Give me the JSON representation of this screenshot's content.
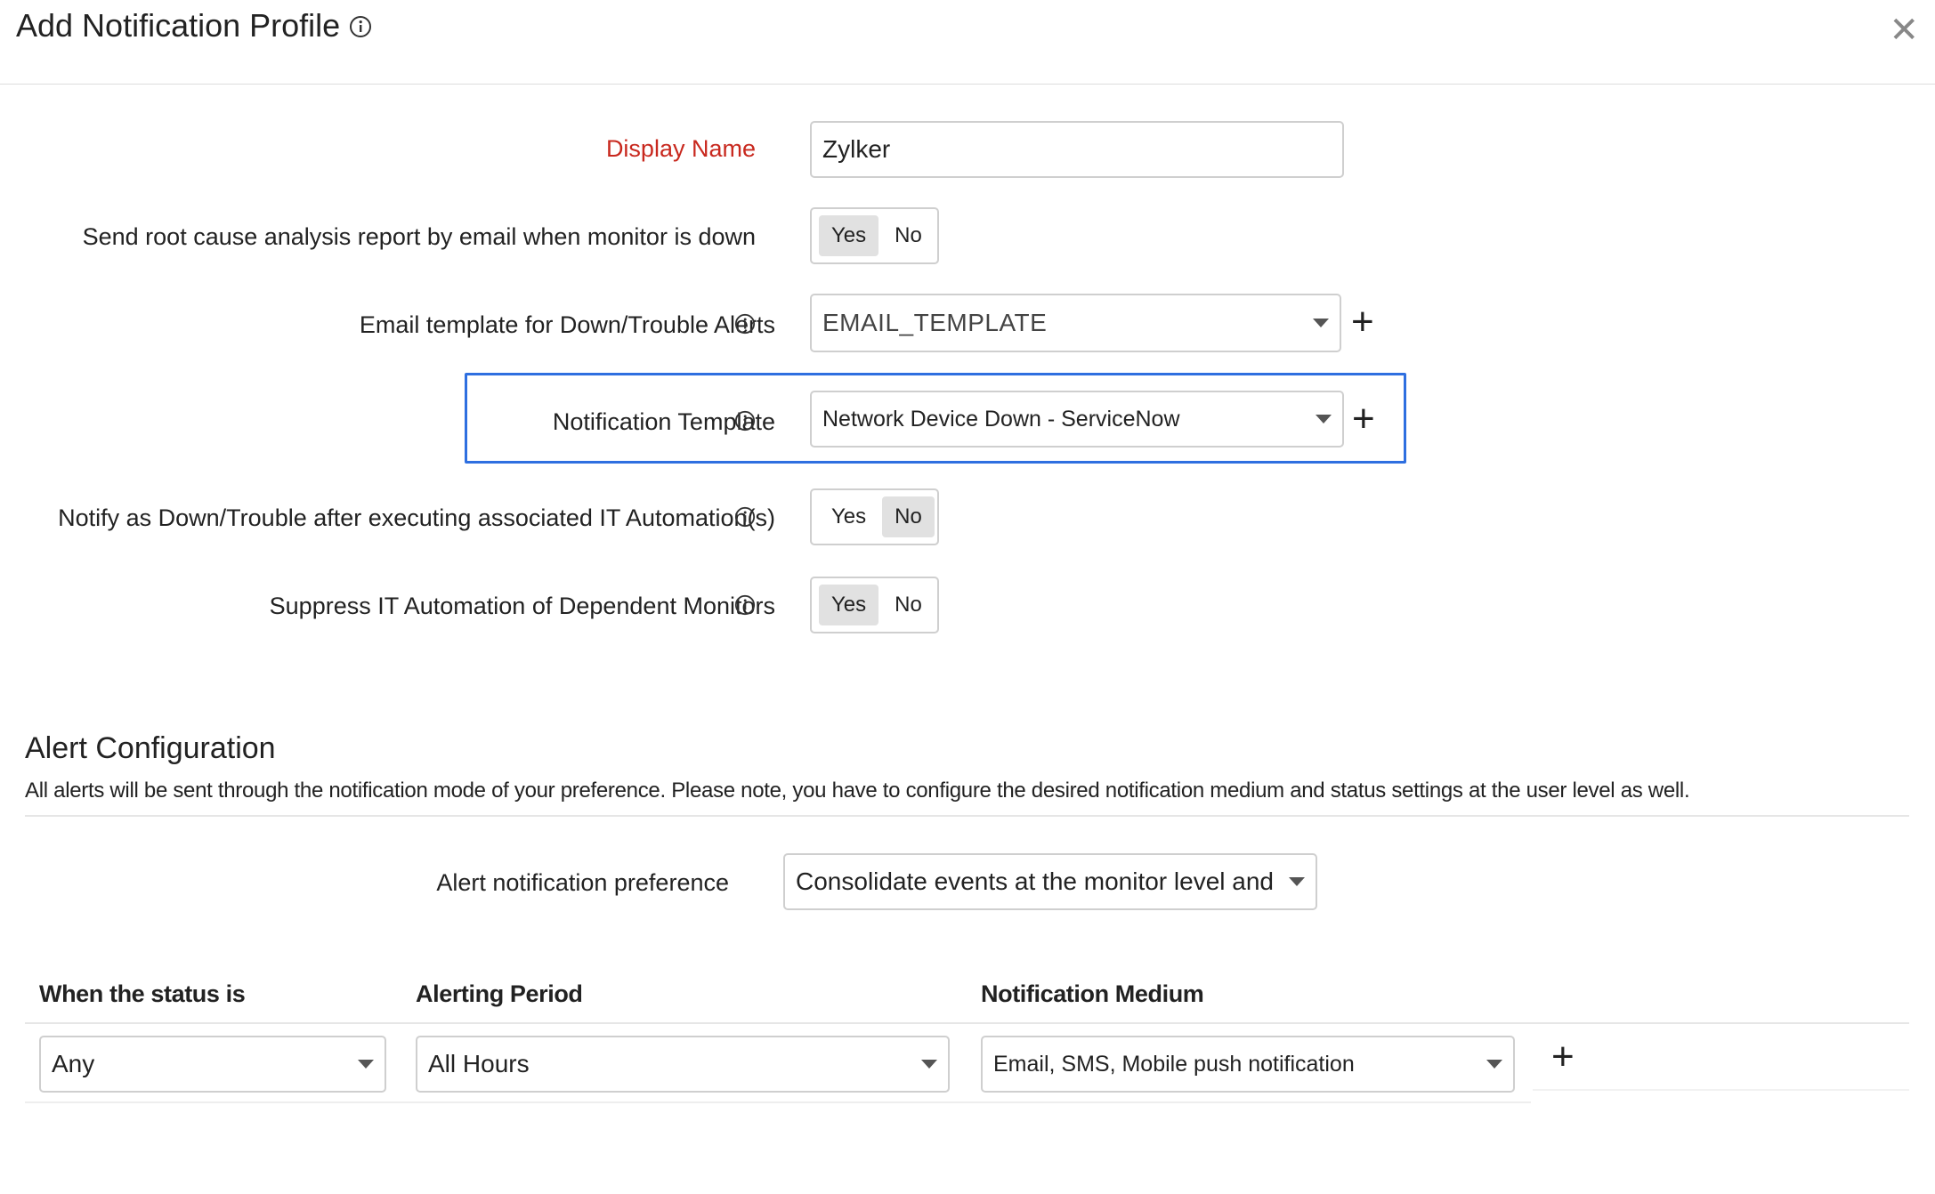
{
  "dialog": {
    "title": "Add Notification Profile",
    "close_label": "✕"
  },
  "form": {
    "display_name": {
      "label": "Display Name",
      "value": "Zylker"
    },
    "rca_email": {
      "label": "Send root cause analysis report by email when monitor is down",
      "yes": "Yes",
      "no": "No",
      "selected": "Yes"
    },
    "email_template": {
      "label": "Email template for Down/Trouble Alerts",
      "value": "EMAIL_TEMPLATE"
    },
    "notification_template": {
      "label": "Notification Template",
      "value": "Network Device Down - ServiceNow"
    },
    "notify_after_automation": {
      "label": "Notify as Down/Trouble after executing associated IT Automation(s)",
      "yes": "Yes",
      "no": "No",
      "selected": "No"
    },
    "suppress_automation": {
      "label": "Suppress IT Automation of Dependent Monitors",
      "yes": "Yes",
      "no": "No",
      "selected": "Yes"
    },
    "add_symbol": "+"
  },
  "alert_config": {
    "title": "Alert Configuration",
    "description": "All alerts will be sent through the notification mode of your preference. Please note, you have to configure the desired notification medium and status settings at the user level as well.",
    "preference": {
      "label": "Alert notification preference",
      "value": "Consolidate events at the monitor level and not"
    },
    "table": {
      "headers": [
        "When the status is",
        "Alerting Period",
        "Notification Medium"
      ],
      "row": {
        "status": "Any",
        "period": "All Hours",
        "medium": "Email, SMS, Mobile push notification"
      }
    }
  },
  "colors": {
    "accent": "#2e6fe0",
    "required": "#c8281e",
    "toggle_on": "#e1e1e1"
  },
  "icons": [
    "info-icon",
    "close-icon",
    "dropdown-caret-icon",
    "plus-icon"
  ]
}
